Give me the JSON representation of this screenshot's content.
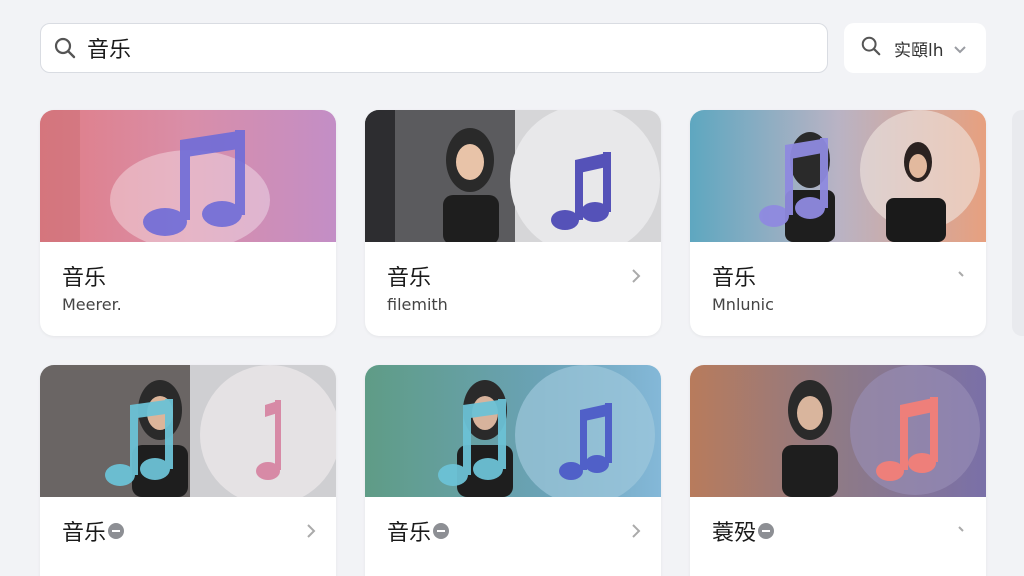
{
  "search": {
    "value": "音乐",
    "placeholder": "音乐"
  },
  "filter": {
    "label": "实頤lh",
    "icon": "search-icon",
    "dropdown_icon": "chevron-down-icon"
  },
  "cards": [
    {
      "title": "音乐",
      "subtitle": "Meerer.",
      "chevron": false,
      "badge": false
    },
    {
      "title": "音乐",
      "subtitle": "filemith",
      "chevron": true,
      "badge": false
    },
    {
      "title": "音乐",
      "subtitle": "Mnlunic",
      "chevron": true,
      "badge": false
    },
    {
      "title": "音乐",
      "subtitle": "",
      "chevron": true,
      "badge": true
    },
    {
      "title": "音乐",
      "subtitle": "",
      "chevron": true,
      "badge": true
    },
    {
      "title": "蓑殁",
      "subtitle": "",
      "chevron": true,
      "badge": true
    }
  ],
  "colors": {
    "background": "#f2f3f6",
    "card": "#ffffff",
    "note_purple": "#6f6cd8",
    "note_blue": "#5b8fd6",
    "note_pink": "#e88a9a",
    "note_coral": "#ee7f7a"
  }
}
